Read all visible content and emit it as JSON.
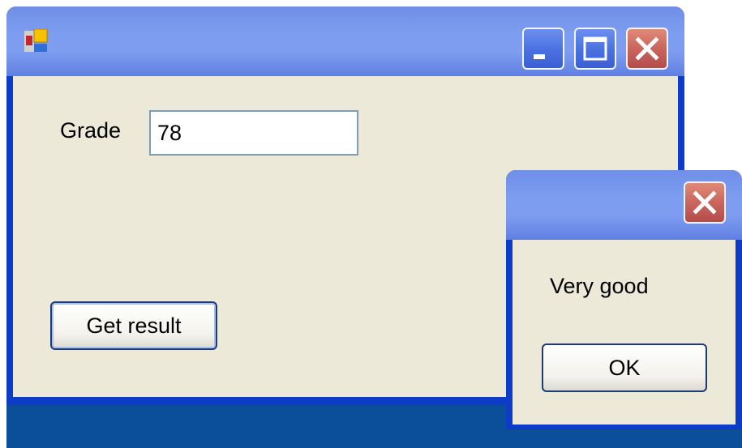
{
  "main_window": {
    "icon": "app-window-icon",
    "controls": {
      "minimize_icon": "minimize-icon",
      "maximize_icon": "maximize-icon",
      "close_icon": "close-icon"
    },
    "form": {
      "grade_label": "Grade",
      "grade_value": "78",
      "get_result_label": "Get result"
    }
  },
  "message_box": {
    "close_icon": "close-icon",
    "message": "Very good",
    "ok_label": "OK"
  },
  "colors": {
    "client_background": "#ece9d8",
    "titlebar": "#7e9cf0",
    "close_button": "#c8625c",
    "desktop": "#0b4f9a"
  }
}
